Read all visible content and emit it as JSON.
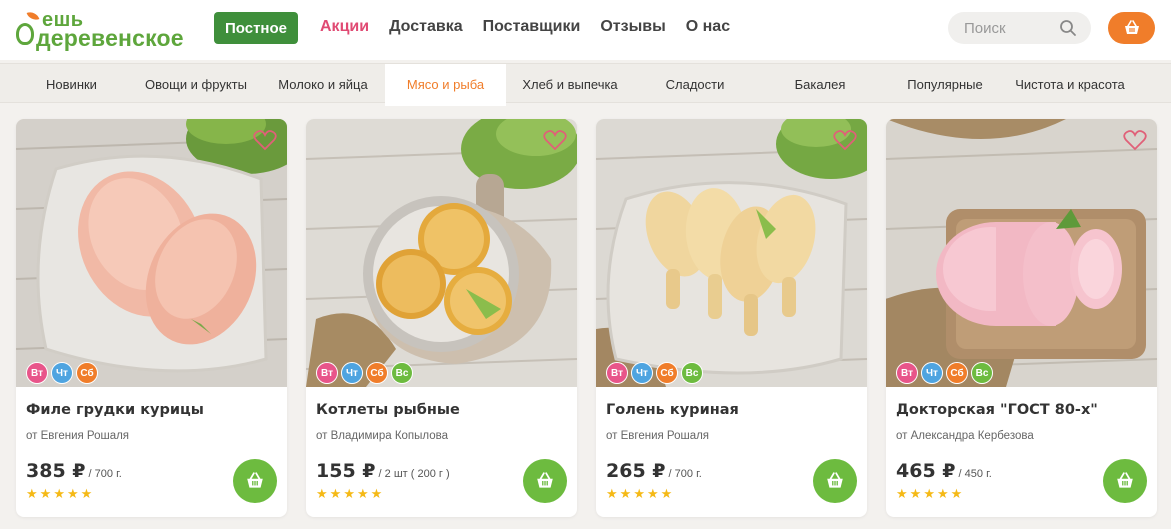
{
  "header": {
    "logo_top": "ешь",
    "logo_bottom": "деревенское",
    "fast_label": "Постное",
    "nav": [
      {
        "label": "Акции",
        "promo": true
      },
      {
        "label": "Доставка",
        "promo": false
      },
      {
        "label": "Поставщики",
        "promo": false
      },
      {
        "label": "Отзывы",
        "promo": false
      },
      {
        "label": "О нас",
        "promo": false
      }
    ],
    "search_placeholder": "Поиск",
    "icons": {
      "search": "search-icon",
      "cart": "basket-icon"
    }
  },
  "categories": [
    {
      "label": "Новинки",
      "active": false
    },
    {
      "label": "Овощи и фрукты",
      "active": false
    },
    {
      "label": "Молоко и яйца",
      "active": false
    },
    {
      "label": "Мясо и рыба",
      "active": true
    },
    {
      "label": "Хлеб и выпечка",
      "active": false
    },
    {
      "label": "Сладости",
      "active": false
    },
    {
      "label": "Бакалея",
      "active": false
    },
    {
      "label": "Популярные",
      "active": false
    },
    {
      "label": "Чистота и красота",
      "active": false
    }
  ],
  "colors": {
    "accent": "#f07d2a",
    "green": "#6dbb3f",
    "fast": "#3f8f3b",
    "promo": "#e04a73"
  },
  "products": [
    {
      "name": "Филе грудки курицы",
      "seller": "от Евгения Рошаля",
      "price": "385 ₽",
      "unit": " / 700 г.",
      "rating": 5,
      "days": [
        "Вт",
        "Чт",
        "Сб"
      ],
      "image": "chicken-breast"
    },
    {
      "name": "Котлеты рыбные",
      "seller": "от Владимира Копылова",
      "price": "155 ₽",
      "unit": " / 2 шт ( 200 г )",
      "rating": 5,
      "days": [
        "Вт",
        "Чт",
        "Сб",
        "Вс"
      ],
      "image": "fish-cutlets"
    },
    {
      "name": "Голень куриная",
      "seller": "от Евгения Рошаля",
      "price": "265 ₽",
      "unit": " / 700 г.",
      "rating": 5,
      "days": [
        "Вт",
        "Чт",
        "Сб",
        "Вс"
      ],
      "image": "chicken-drumsticks"
    },
    {
      "name": "Докторская \"ГОСТ 80-х\"",
      "seller": "от Александра Кербезова",
      "price": "465 ₽",
      "unit": " / 450 г.",
      "rating": 5,
      "days": [
        "Вт",
        "Чт",
        "Сб",
        "Вс"
      ],
      "image": "doctor-sausage"
    }
  ]
}
